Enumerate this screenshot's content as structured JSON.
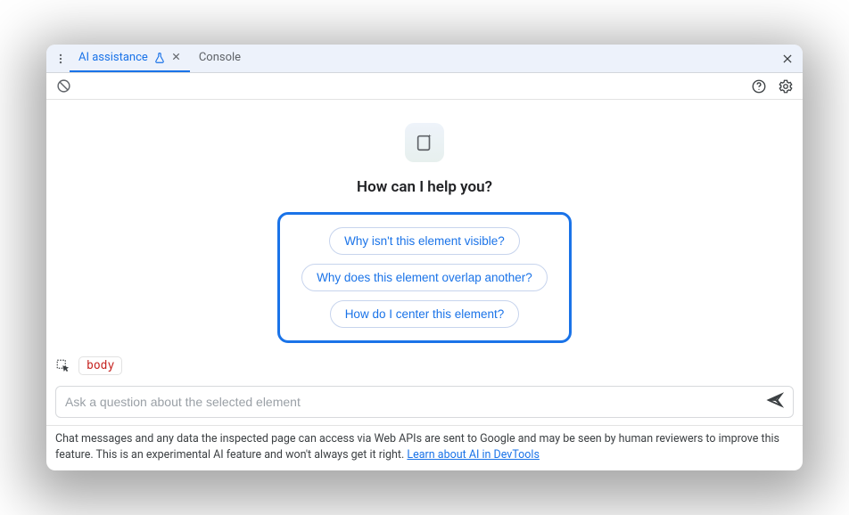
{
  "tabs": {
    "active": {
      "label": "AI assistance"
    },
    "inactive": {
      "label": "Console"
    }
  },
  "heading": "How can I help you?",
  "suggestions": [
    "Why isn't this element visible?",
    "Why does this element overlap another?",
    "How do I center this element?"
  ],
  "context": {
    "element": "body"
  },
  "input": {
    "placeholder": "Ask a question about the selected element"
  },
  "footer": {
    "text": "Chat messages and any data the inspected page can access via Web APIs are sent to Google and may be seen by human reviewers to improve this feature. This is an experimental AI feature and won't always get it right. ",
    "link": "Learn about AI in DevTools"
  }
}
